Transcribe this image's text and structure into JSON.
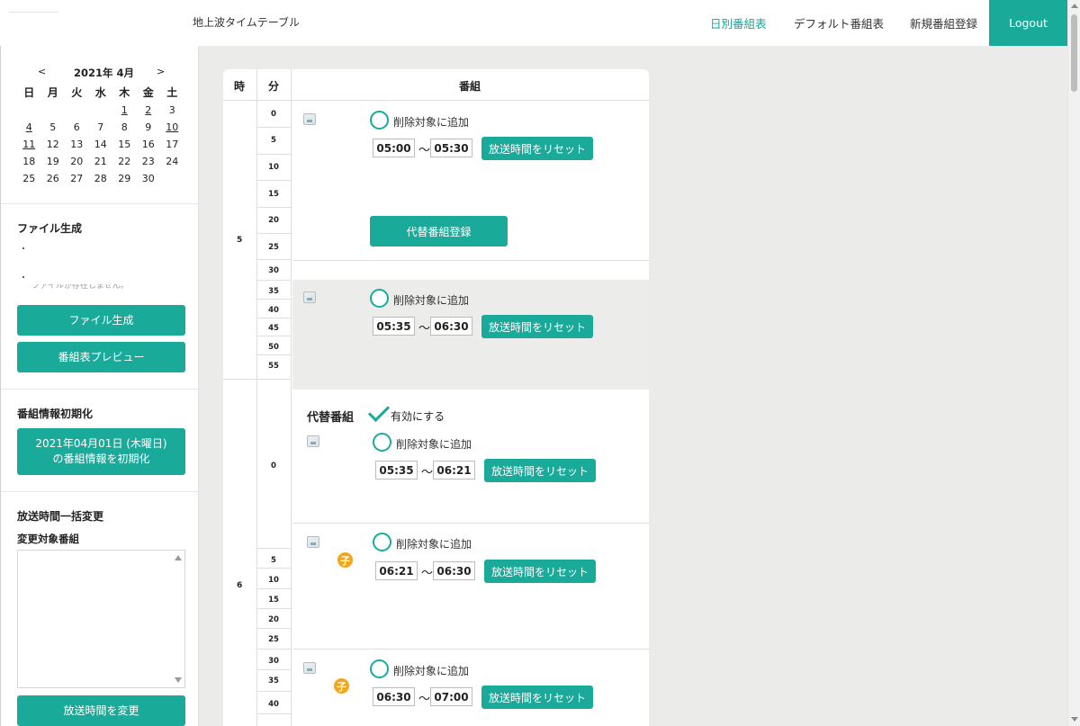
{
  "header": {
    "app_title": "地上波タイムテーブル",
    "nav": [
      "日別番組表",
      "デフォルト番組表",
      "新規番組登録"
    ],
    "logout": "Logout",
    "accent": "#1aaa9a"
  },
  "calendar": {
    "prev": "<",
    "next": ">",
    "month": "2021年 4月",
    "weekdays": [
      "日",
      "月",
      "火",
      "水",
      "木",
      "金",
      "土"
    ],
    "rows": [
      [
        "",
        "",
        "",
        "",
        "1",
        "2",
        "3"
      ],
      [
        "4",
        "5",
        "6",
        "7",
        "8",
        "9",
        "10"
      ],
      [
        "11",
        "12",
        "13",
        "14",
        "15",
        "16",
        "17"
      ],
      [
        "18",
        "19",
        "20",
        "21",
        "22",
        "23",
        "24"
      ],
      [
        "25",
        "26",
        "27",
        "28",
        "29",
        "30",
        ""
      ]
    ],
    "underlined": [
      "1",
      "2",
      "4",
      "10",
      "11"
    ]
  },
  "sidebar": {
    "file_section_title": "ファイル生成",
    "file_note": "ファイルが存在しません。",
    "file_button": "ファイル生成",
    "preview_button": "番組表プレビュー",
    "init_section_title": "番組情報初期化",
    "init_button_line1": "2021年04月01日 (木曜日)",
    "init_button_line2": "の番組情報を初期化",
    "bulk_section_title": "放送時間一括変更",
    "target_label": "変更対象番組",
    "change_button": "放送時間を変更"
  },
  "table": {
    "headers": {
      "hour": "時",
      "minute": "分",
      "program": "番組"
    },
    "hours": [
      "5",
      "6"
    ],
    "minutes_5": [
      "0",
      "5",
      "10",
      "15",
      "20",
      "25",
      "30",
      "35",
      "40",
      "45",
      "50",
      "55"
    ],
    "minutes_6": [
      "0",
      "5",
      "10",
      "15",
      "20",
      "25",
      "30",
      "35",
      "40"
    ],
    "delete_label": "削除対象に追加",
    "reset_label": "放送時間をリセット",
    "tilde": "〜",
    "alt_register": "代替番組登録",
    "alt_title": "代替番組",
    "alt_enable": "有効にする",
    "kid_badge": "子",
    "programs": [
      {
        "start": "05:00",
        "end": "05:30"
      },
      {
        "start": "05:35",
        "end": "06:30"
      },
      {
        "start": "05:35",
        "end": "06:21"
      },
      {
        "start": "06:21",
        "end": "06:30"
      },
      {
        "start": "06:30",
        "end": "07:00"
      }
    ]
  }
}
